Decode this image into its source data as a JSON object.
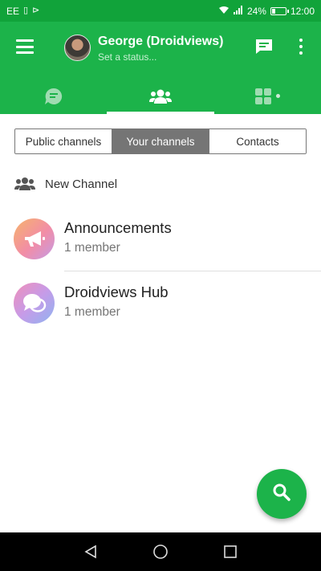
{
  "status_bar": {
    "carrier": "EE",
    "battery": "24%",
    "battery_level": 0.24,
    "time": "12:00",
    "icons": [
      "sim-icon",
      "notification-icon",
      "wifi-icon",
      "signal-icon",
      "battery-icon"
    ]
  },
  "header": {
    "user_name": "George (Droidviews)",
    "status_placeholder": "Set a status...",
    "icons": [
      "menu-icon",
      "avatar",
      "compose-message-icon",
      "more-options-icon"
    ]
  },
  "tabs": [
    {
      "name": "chats",
      "icon": "chat-bubble-icon",
      "active": false
    },
    {
      "name": "channels",
      "icon": "group-icon",
      "active": true
    },
    {
      "name": "apps",
      "icon": "grid-icon",
      "active": false,
      "indicator": true
    }
  ],
  "channel_filter": {
    "options": [
      "Public channels",
      "Your channels",
      "Contacts"
    ],
    "selected": "Your channels"
  },
  "new_channel": {
    "label": "New Channel",
    "icon": "group-add-icon"
  },
  "channels": [
    {
      "name": "Announcements",
      "members": "1 member",
      "icon": "megaphone-icon"
    },
    {
      "name": "Droidviews Hub",
      "members": "1 member",
      "icon": "chat-bubbles-icon"
    }
  ],
  "fab": {
    "icon": "search-icon"
  },
  "nav_bar": {
    "icons": [
      "back-icon",
      "home-icon",
      "recents-icon"
    ]
  },
  "colors": {
    "status_bar": "#11a33a",
    "primary": "#1cb34a",
    "segment_active": "#757575"
  }
}
